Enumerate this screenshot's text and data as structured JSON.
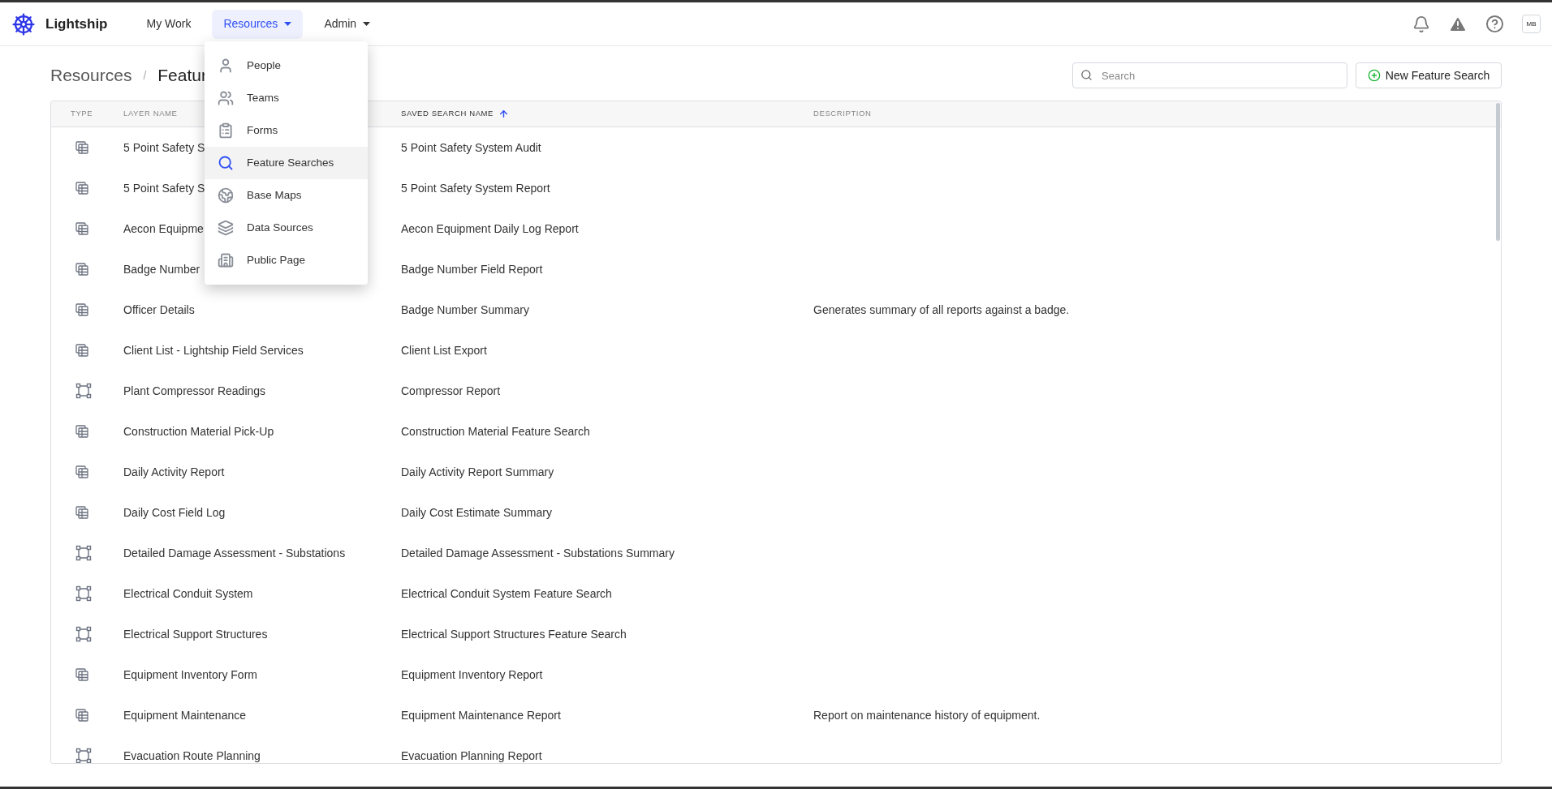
{
  "app": {
    "name": "Lightship"
  },
  "nav": [
    {
      "label": "My Work",
      "selected": false,
      "dropdown": false
    },
    {
      "label": "Resources",
      "selected": true,
      "dropdown": true
    },
    {
      "label": "Admin",
      "selected": false,
      "dropdown": true
    }
  ],
  "user": {
    "initials": "MB"
  },
  "menu": [
    {
      "label": "People",
      "selected": false
    },
    {
      "label": "Teams",
      "selected": false
    },
    {
      "label": "Forms",
      "selected": false
    },
    {
      "label": "Feature Searches",
      "selected": true
    },
    {
      "label": "Base Maps",
      "selected": false
    },
    {
      "label": "Data Sources",
      "selected": false
    },
    {
      "label": "Public Page",
      "selected": false
    }
  ],
  "breadcrumb": [
    "Resources",
    "Featur"
  ],
  "breadcrumb_separator": "/",
  "search": {
    "placeholder": "Search"
  },
  "new_button": "New Feature Search",
  "table": {
    "columns": [
      {
        "label": "TYPE",
        "sorted": false
      },
      {
        "label": "LAYER NAME",
        "sorted": false
      },
      {
        "label": "SAVED SEARCH NAME",
        "sorted": true
      },
      {
        "label": "DESCRIPTION",
        "sorted": false
      }
    ],
    "rows": [
      {
        "kind": "table",
        "layer": "5 Point Safety S",
        "name": "5 Point Safety System Audit"
      },
      {
        "kind": "table",
        "layer": "5 Point Safety S",
        "name": "5 Point Safety System Report"
      },
      {
        "kind": "table",
        "layer": "Aecon Equipme",
        "name": "Aecon Equipment Daily Log Report"
      },
      {
        "kind": "table",
        "layer": "Badge Number",
        "name": "Badge Number Field Report"
      },
      {
        "kind": "table",
        "layer": "Officer Details",
        "name": "Badge Number Summary",
        "description": "Generates summary of all reports against a badge."
      },
      {
        "kind": "table",
        "layer": "Client List - Lightship Field Services",
        "name": "Client List Export"
      },
      {
        "kind": "polygon",
        "layer": "Plant Compressor Readings",
        "name": "Compressor Report"
      },
      {
        "kind": "table",
        "layer": "Construction Material Pick-Up",
        "name": "Construction Material Feature Search"
      },
      {
        "kind": "table",
        "layer": "Daily Activity Report",
        "name": "Daily Activity Report Summary"
      },
      {
        "kind": "table",
        "layer": "Daily Cost Field Log",
        "name": "Daily Cost Estimate Summary"
      },
      {
        "kind": "polygon",
        "layer": "Detailed Damage Assessment - Substations",
        "name": "Detailed Damage Assessment - Substations Summary"
      },
      {
        "kind": "polygon",
        "layer": "Electrical Conduit System",
        "name": "Electrical Conduit System Feature Search"
      },
      {
        "kind": "polygon",
        "layer": "Electrical Support Structures",
        "name": "Electrical Support Structures Feature Search"
      },
      {
        "kind": "table",
        "layer": "Equipment Inventory Form",
        "name": "Equipment Inventory Report"
      },
      {
        "kind": "table",
        "layer": "Equipment Maintenance",
        "name": "Equipment Maintenance Report",
        "description": "Report on maintenance history of equipment."
      },
      {
        "kind": "polygon",
        "layer": "Evacuation Route Planning",
        "name": "Evacuation Planning Report"
      }
    ]
  }
}
